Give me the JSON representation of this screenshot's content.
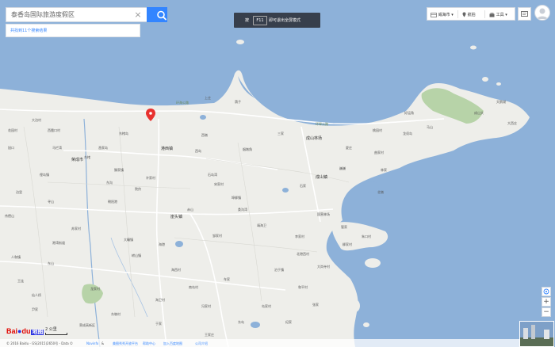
{
  "search": {
    "value": "泰香岛国际旅游度假区",
    "suggestion": "共找到11个搜索结果"
  },
  "fullscreen_notice": {
    "prefix": "按",
    "key": "F11",
    "suffix": "即可退出全屏模式"
  },
  "toolbar": {
    "city": "威海市",
    "location": "航拍",
    "tools": "工具"
  },
  "map_labels": [
    "环翠公路",
    "环海公路",
    "成山林场",
    "成山镇",
    "港西镇",
    "崖头镇",
    "荣成市",
    "大泊村",
    "花园村",
    "西霞口村",
    "东楮岛",
    "渔家岛",
    "马栏湾",
    "旭口",
    "俚岛镇",
    "滕家镇",
    "院夼",
    "朝阳港",
    "寻山",
    "石岛湾",
    "埠柳镇",
    "宋家村",
    "赤山",
    "桑沟湾",
    "靖海卫",
    "邹家村",
    "大疃镇",
    "崂山镇",
    "苏家村",
    "港湾街道",
    "人和镇",
    "东山",
    "王连",
    "龙家村",
    "海西村",
    "南岛村",
    "车家",
    "泊于镇",
    "北港西村",
    "大岚寺村",
    "和平村",
    "岛家村",
    "冯家村",
    "海卫村",
    "东墩村",
    "尹家",
    "大西庄",
    "成山头",
    "天鹅湖",
    "好运角",
    "马山",
    "龙须岛",
    "桃园村",
    "夏庄",
    "曲家村",
    "林家",
    "巍巍",
    "上庄",
    "荫子",
    "三家",
    "烟墩角",
    "西墩",
    "许家村",
    "石家",
    "管家",
    "朱口村",
    "柳家村",
    "李家村",
    "于家",
    "东楮",
    "伟德山",
    "仙人桥",
    "荣成高新区",
    "泊里",
    "西岛",
    "海港",
    "国营林场",
    "王家庄",
    "纪家",
    "张家",
    "东岛",
    "北墩",
    "东沟"
  ],
  "zoom": {
    "plus": "+",
    "minus": "−"
  },
  "scale": {
    "text": "2 公里"
  },
  "logo": {
    "part1": "Bai",
    "part2": "du",
    "part3": "地图"
  },
  "footer": {
    "copyright": "© 2016 Baidu - GS(2015)2650号 - Data ©",
    "links": [
      "Navinfo",
      "&",
      "美图秀秀开放平台",
      "帮助中心",
      "加入百度地图",
      "公司介绍"
    ]
  },
  "colors": {
    "sea": "#8db1d9",
    "land": "#eeeeea",
    "park": "#b7d3a8",
    "accent": "#3385ff",
    "marker": "#e8322f"
  }
}
